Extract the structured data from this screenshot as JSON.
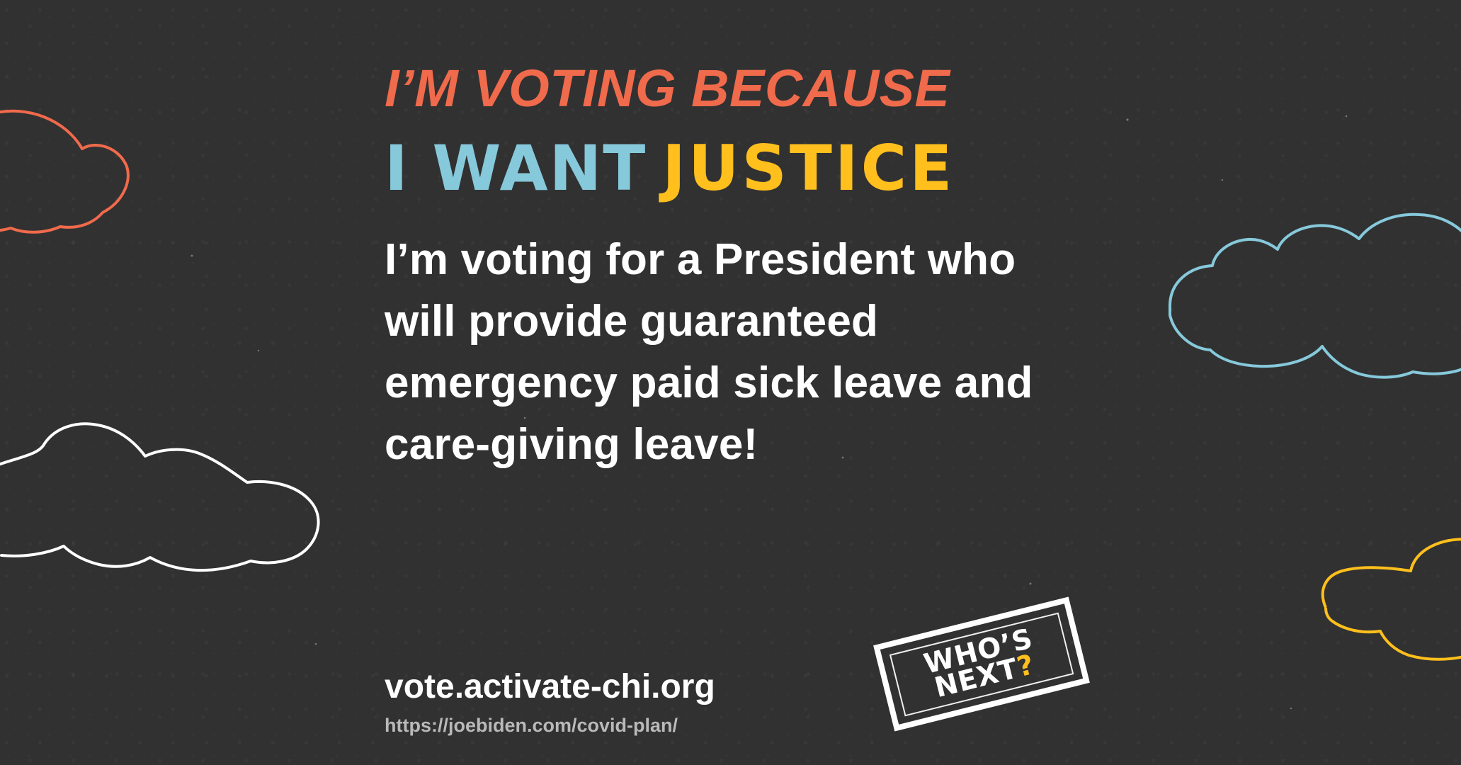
{
  "colors": {
    "background": "#313131",
    "coral": "#f06a4c",
    "blue": "#86c9db",
    "yellow": "#ffbf1d",
    "white": "#ffffff",
    "muted": "#b9b9b9"
  },
  "poster": {
    "kicker": "I’M VOTING BECAUSE",
    "headline_part1": "I WANT",
    "headline_part2": "JUSTICE",
    "statement": "I’m voting for a President who will provide guaranteed emergency paid sick leave and care-giving leave!",
    "website": "vote.activate-chi.org",
    "source_url": "https://joebiden.com/covid-plan/"
  },
  "badge": {
    "line1": "WHO’S",
    "line2": "NEXT",
    "question_mark": "?"
  },
  "icons": [
    "cloud-icon",
    "cloud-icon",
    "cloud-icon",
    "cloud-icon"
  ]
}
